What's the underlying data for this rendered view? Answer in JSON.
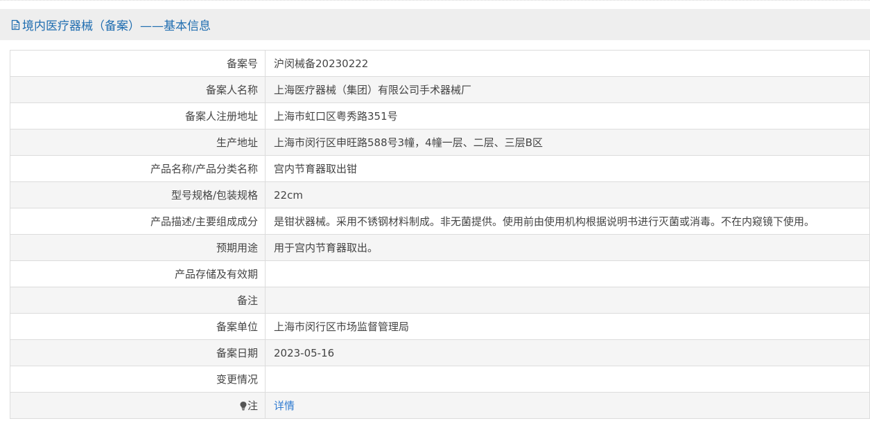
{
  "header": {
    "title": "境内医疗器械（备案）——基本信息",
    "icon": "document-icon",
    "title_color": "#1f6db0"
  },
  "rows": [
    {
      "label": "备案号",
      "value": "沪闵械备20230222"
    },
    {
      "label": "备案人名称",
      "value": "上海医疗器械（集团）有限公司手术器械厂"
    },
    {
      "label": "备案人注册地址",
      "value": "上海市虹口区粤秀路351号"
    },
    {
      "label": "生产地址",
      "value": "上海市闵行区申旺路588号3幢，4幢一层、二层、三层B区"
    },
    {
      "label": "产品名称/产品分类名称",
      "value": "宫内节育器取出钳"
    },
    {
      "label": "型号规格/包装规格",
      "value": "22cm"
    },
    {
      "label": "产品描述/主要组成成分",
      "value": "是钳状器械。采用不锈钢材料制成。非无菌提供。使用前由使用机构根据说明书进行灭菌或消毒。不在内窥镜下使用。"
    },
    {
      "label": "预期用途",
      "value": "用于宫内节育器取出。"
    },
    {
      "label": "产品存储及有效期",
      "value": ""
    },
    {
      "label": "备注",
      "value": ""
    },
    {
      "label": "备案单位",
      "value": "上海市闵行区市场监督管理局"
    },
    {
      "label": "备案日期",
      "value": "2023-05-16"
    },
    {
      "label": "变更情况",
      "value": ""
    }
  ],
  "note": {
    "label": "注",
    "icon": "lightbulb-icon",
    "link": "详情",
    "link_color": "#2f7bd1"
  }
}
